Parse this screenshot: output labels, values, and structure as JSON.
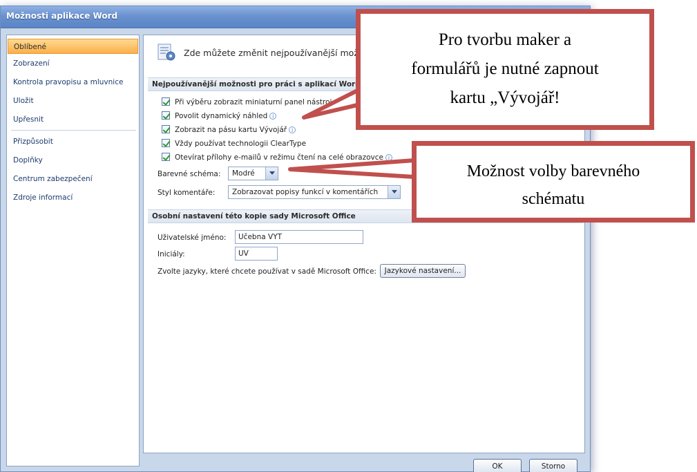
{
  "window": {
    "title": "Možnosti aplikace Word"
  },
  "nav": {
    "items": [
      {
        "label": "Oblíbené",
        "active": true
      },
      {
        "label": "Zobrazení"
      },
      {
        "label": "Kontrola pravopisu a mluvnice"
      },
      {
        "label": "Uložit"
      },
      {
        "label": "Upřesnit"
      },
      {
        "label": "Přizpůsobit"
      },
      {
        "label": "Doplňky"
      },
      {
        "label": "Centrum zabezpečení"
      },
      {
        "label": "Zdroje informací"
      }
    ]
  },
  "content": {
    "header_text": "Zde můžete změnit nejpoužívanější možno",
    "section1_title": "Nejpoužívanější možnosti pro práci s aplikací Word",
    "options": [
      "Při výběru zobrazit miniaturní panel nástroj",
      "Povolit dynamický náhled",
      "Zobrazit na pásu kartu Vývojář",
      "Vždy používat technologii ClearType",
      "Otevírat přílohy e-mailů v režimu čtení na celé obrazovce"
    ],
    "color_scheme": {
      "label": "Barevné schéma:",
      "value": "Modré"
    },
    "tooltip_style": {
      "label": "Styl komentáře:",
      "value": "Zobrazovat popisy funkcí v komentářích"
    },
    "section2_title": "Osobní nastavení této kopie sady Microsoft Office",
    "username": {
      "label": "Uživatelské jméno:",
      "value": "Učebna VYT"
    },
    "initials": {
      "label": "Iniciály:",
      "value": "UV"
    },
    "language": {
      "label": "Zvolte jazyky, které chcete používat v sadě Microsoft Office:",
      "button": "Jazykové nastavení..."
    }
  },
  "buttons": {
    "ok": "OK",
    "cancel": "Storno"
  },
  "callouts": {
    "developer": {
      "line1": "Pro tvorbu maker a",
      "line2": "formulářů je nutné zapnout",
      "line3": "kartu „Vývojář!"
    },
    "scheme": {
      "line1": "Možnost volby barevného",
      "line2": "schématu"
    }
  },
  "colors": {
    "callout_border": "#c0504d",
    "active_nav": "#fbb04a",
    "title_bar": "#6b92cf"
  }
}
